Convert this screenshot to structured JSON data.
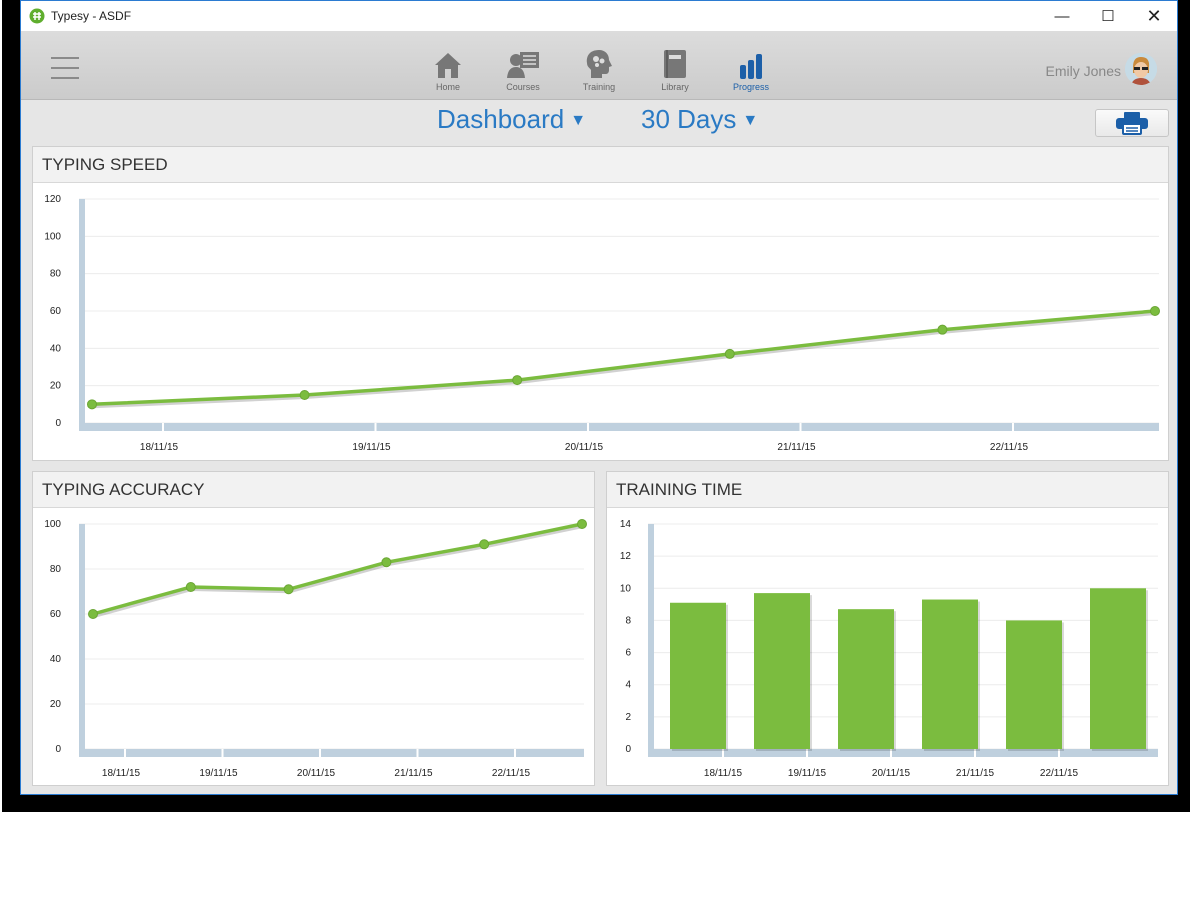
{
  "window": {
    "title": "Typesy - ASDF",
    "minimize": "—",
    "maximize": "☐",
    "close": "✕"
  },
  "nav": {
    "items": [
      {
        "label": "Home",
        "icon": "home-icon"
      },
      {
        "label": "Courses",
        "icon": "courses-icon"
      },
      {
        "label": "Training",
        "icon": "training-brain-icon"
      },
      {
        "label": "Library",
        "icon": "library-book-icon"
      },
      {
        "label": "Progress",
        "icon": "progress-bars-icon",
        "active": true
      }
    ],
    "user_name": "Emily Jones"
  },
  "toolbar": {
    "view_dropdown": "Dashboard",
    "range_dropdown": "30 Days",
    "print_icon": "printer-icon"
  },
  "colors": {
    "accent": "#2a7ac4",
    "series": "#7bbc3f",
    "axis": "#bfd0de"
  },
  "panels": {
    "speed_title": "TYPING SPEED",
    "accuracy_title": "TYPING ACCURACY",
    "time_title": "TRAINING TIME"
  },
  "chart_data": [
    {
      "type": "line",
      "title": "TYPING SPEED",
      "x_tick_labels": [
        "18/11/15",
        "19/11/15",
        "20/11/15",
        "21/11/15",
        "22/11/15"
      ],
      "y_ticks": [
        0,
        20,
        40,
        60,
        80,
        100,
        120
      ],
      "ylim": [
        0,
        120
      ],
      "series": [
        {
          "values": [
            10,
            15,
            23,
            37,
            50,
            60
          ]
        }
      ],
      "grid": true
    },
    {
      "type": "line",
      "title": "TYPING ACCURACY",
      "x_tick_labels": [
        "18/11/15",
        "19/11/15",
        "20/11/15",
        "21/11/15",
        "22/11/15"
      ],
      "y_ticks": [
        0,
        20,
        40,
        60,
        80,
        100
      ],
      "ylim": [
        0,
        100
      ],
      "series": [
        {
          "values": [
            60,
            72,
            71,
            83,
            91,
            100
          ]
        }
      ],
      "grid": true
    },
    {
      "type": "bar",
      "title": "TRAINING TIME",
      "x_tick_labels": [
        "18/11/15",
        "19/11/15",
        "20/11/15",
        "21/11/15",
        "22/11/15"
      ],
      "y_ticks": [
        0,
        2,
        4,
        6,
        8,
        10,
        12,
        14
      ],
      "ylim": [
        0,
        14
      ],
      "values": [
        9.1,
        9.7,
        8.7,
        9.3,
        8.0,
        10.0
      ],
      "grid": true
    }
  ]
}
